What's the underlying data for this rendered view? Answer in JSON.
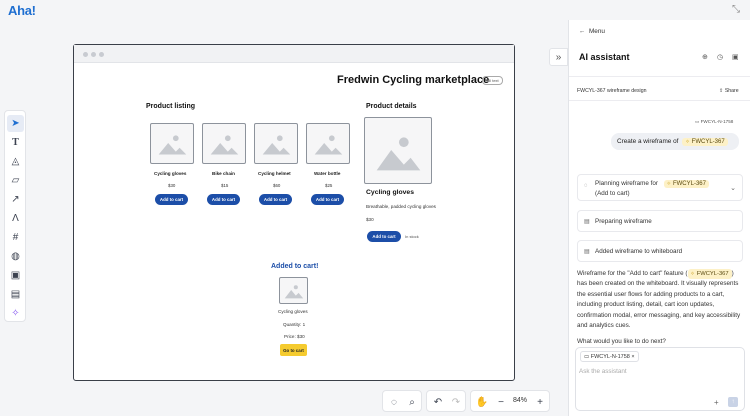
{
  "app": {
    "logo": "Aha!"
  },
  "mockup": {
    "title": "Fredwin Cycling marketplace",
    "badge": "Fill text",
    "listing_title": "Product listing",
    "details_title": "Product details",
    "products": [
      {
        "name": "Cycling gloves",
        "price": "$30",
        "button": "Add to cart"
      },
      {
        "name": "Bike chain",
        "price": "$15",
        "button": "Add to cart"
      },
      {
        "name": "Cycling helmet",
        "price": "$60",
        "button": "Add to cart"
      },
      {
        "name": "Water bottle",
        "price": "$25",
        "button": "Add to cart"
      }
    ],
    "detail": {
      "name": "Cycling gloves",
      "description": "Breathable, padded cycling gloves",
      "price": "$30",
      "button": "Add to cart",
      "stock": "In stock"
    },
    "added": {
      "title": "Added to cart!",
      "name": "Cycling gloves",
      "quantity": "Quantity: 1",
      "price": "Price: $30",
      "button": "Go to cart"
    }
  },
  "controls": {
    "zoom": "84%"
  },
  "panel": {
    "menu": "Menu",
    "title": "AI assistant",
    "conversation": "FWCYL-367 wireframe design",
    "share": "Share",
    "ref_chip": "FWCYL-N-1758",
    "user_message": "Create a wireframe of",
    "record": "FWCYL-367",
    "steps": {
      "planning": "Planning wireframe for",
      "planning_tail": "(Add to cart)",
      "preparing": "Preparing wireframe",
      "added": "Added wireframe to whiteboard"
    },
    "response": {
      "lead": "Wireframe for the \"Add to cart\" feature (",
      "tail": ") has been created on the whiteboard. It visually represents the essential user flows for adding products to a cart, including product listing, detail, cart icon updates, confirmation modal, error messaging, and key accessibility and analytics cues."
    },
    "question": "What would you like to do next?",
    "attachment": "FWCYL-N-1758",
    "placeholder": "Ask the assistant"
  }
}
